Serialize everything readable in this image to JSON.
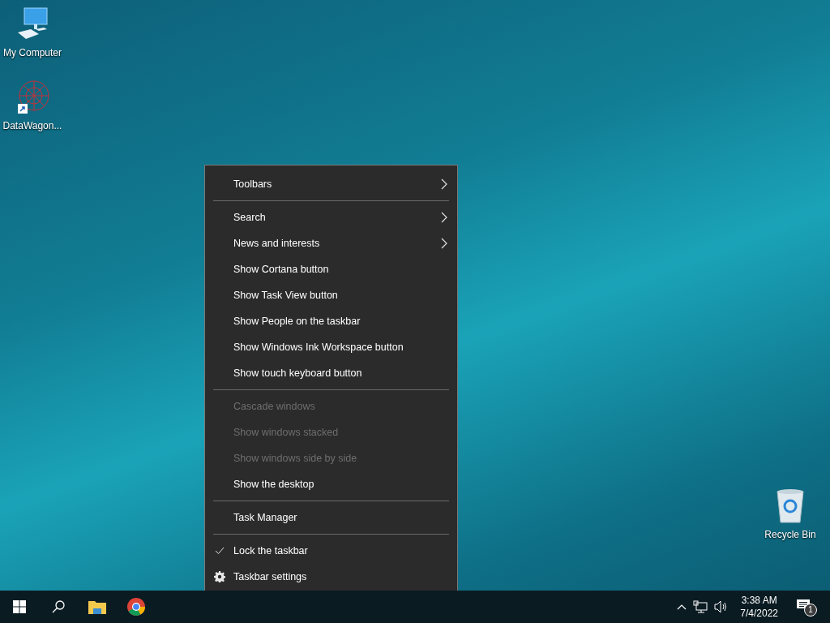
{
  "desktop_icons": [
    {
      "label": "My Computer",
      "kind": "computer"
    },
    {
      "label": "DataWagon...",
      "kind": "shortcut"
    }
  ],
  "recycle_bin": {
    "label": "Recycle Bin"
  },
  "context_menu": {
    "groups": [
      [
        {
          "label": "Toolbars",
          "kind": "submenu",
          "disabled": false,
          "checked": false
        }
      ],
      [
        {
          "label": "Search",
          "kind": "submenu",
          "disabled": false,
          "checked": false
        },
        {
          "label": "News and interests",
          "kind": "submenu",
          "disabled": false,
          "checked": false
        },
        {
          "label": "Show Cortana button",
          "kind": "command",
          "disabled": false,
          "checked": false
        },
        {
          "label": "Show Task View button",
          "kind": "command",
          "disabled": false,
          "checked": false
        },
        {
          "label": "Show People on the taskbar",
          "kind": "command",
          "disabled": false,
          "checked": false
        },
        {
          "label": "Show Windows Ink Workspace button",
          "kind": "command",
          "disabled": false,
          "checked": false
        },
        {
          "label": "Show touch keyboard button",
          "kind": "command",
          "disabled": false,
          "checked": false
        }
      ],
      [
        {
          "label": "Cascade windows",
          "kind": "command",
          "disabled": true,
          "checked": false
        },
        {
          "label": "Show windows stacked",
          "kind": "command",
          "disabled": true,
          "checked": false
        },
        {
          "label": "Show windows side by side",
          "kind": "command",
          "disabled": true,
          "checked": false
        },
        {
          "label": "Show the desktop",
          "kind": "command",
          "disabled": false,
          "checked": false
        }
      ],
      [
        {
          "label": "Task Manager",
          "kind": "command",
          "disabled": false,
          "checked": false
        }
      ],
      [
        {
          "label": "Lock the taskbar",
          "kind": "command",
          "disabled": false,
          "checked": true
        },
        {
          "label": "Taskbar settings",
          "kind": "settings",
          "disabled": false,
          "checked": false
        }
      ]
    ]
  },
  "taskbar": {
    "pinned": [
      {
        "kind": "start"
      },
      {
        "kind": "search"
      },
      {
        "kind": "explorer"
      },
      {
        "kind": "browser"
      }
    ],
    "clock": {
      "time": "3:38 AM",
      "date": "7/4/2022"
    },
    "notification_count": "1"
  }
}
